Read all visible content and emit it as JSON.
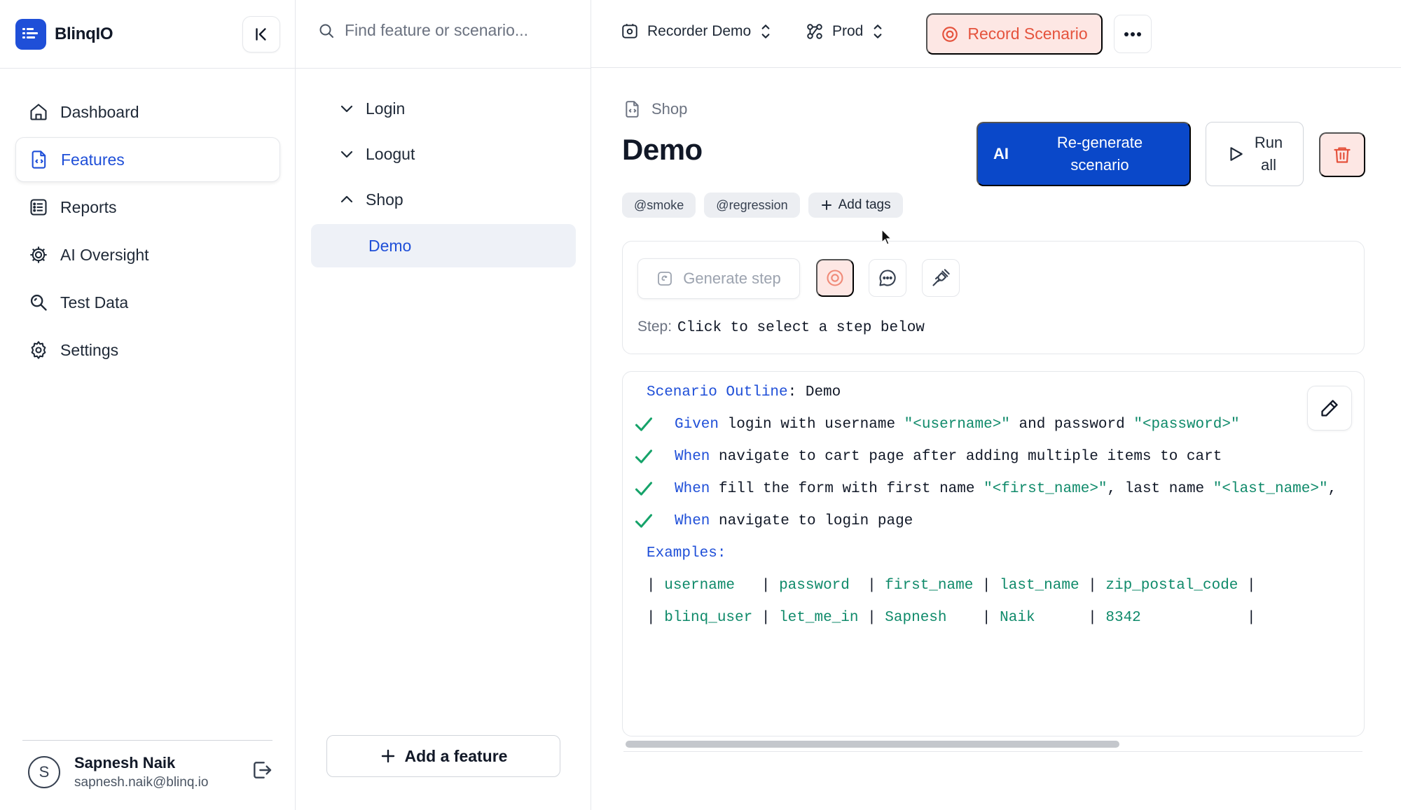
{
  "app": {
    "brand_name": "BlinqIO",
    "accent_color": "#1f4fd8",
    "danger_color": "#e5533d"
  },
  "sidebar": {
    "items": [
      {
        "label": "Dashboard",
        "icon": "home-icon"
      },
      {
        "label": "Features",
        "icon": "feature-file-icon",
        "active": true
      },
      {
        "label": "Reports",
        "icon": "list-icon"
      },
      {
        "label": "AI Oversight",
        "icon": "ai-gear-icon"
      },
      {
        "label": "Test Data",
        "icon": "magnifier-icon"
      },
      {
        "label": "Settings",
        "icon": "gear-icon"
      }
    ],
    "user": {
      "initial": "S",
      "name": "Sapnesh Naik",
      "email": "sapnesh.naik@blinq.io"
    }
  },
  "features_panel": {
    "search_placeholder": "Find feature or scenario...",
    "tree": [
      {
        "label": "Login",
        "expanded": false
      },
      {
        "label": "Loogut",
        "expanded": false
      },
      {
        "label": "Shop",
        "expanded": true
      }
    ],
    "selected_child": "Demo",
    "add_feature_label": "Add a feature"
  },
  "topbar": {
    "project": "Recorder Demo",
    "environment": "Prod",
    "record_label": "Record Scenario"
  },
  "scenario": {
    "breadcrumb": "Shop",
    "title": "Demo",
    "regen_ai": "AI",
    "regen_label_1": "Re-generate",
    "regen_label_2": "scenario",
    "run_label_1": "Run",
    "run_label_2": "all",
    "tags": [
      "@smoke",
      "@regression"
    ],
    "add_tags_label": "Add tags",
    "generate_step_label": "Generate step",
    "step_prefix": "Step:",
    "step_value": "Click to select a step below"
  },
  "gherkin": {
    "outline_keyword": "Scenario Outline",
    "outline_name": "Demo",
    "steps": [
      {
        "keyword": "Given",
        "parts": [
          {
            "t": "txt",
            "v": " login with username "
          },
          {
            "t": "str",
            "v": "\"<username>\""
          },
          {
            "t": "txt",
            "v": " and password "
          },
          {
            "t": "str",
            "v": "\"<password>\""
          }
        ]
      },
      {
        "keyword": "When",
        "parts": [
          {
            "t": "txt",
            "v": " navigate to cart page after adding multiple items to cart"
          }
        ]
      },
      {
        "keyword": "When",
        "parts": [
          {
            "t": "txt",
            "v": " fill the form with first name "
          },
          {
            "t": "str",
            "v": "\"<first_name>\""
          },
          {
            "t": "txt",
            "v": ", last name "
          },
          {
            "t": "str",
            "v": "\"<last_name>\""
          },
          {
            "t": "txt",
            "v": ","
          }
        ]
      },
      {
        "keyword": "When",
        "parts": [
          {
            "t": "txt",
            "v": " navigate to login page"
          }
        ]
      }
    ],
    "examples_label": "Examples:",
    "table_header": [
      "username  ",
      "password ",
      "first_name",
      "last_name",
      "zip_postal_code"
    ],
    "table_rows": [
      [
        "blinq_user",
        "let_me_in",
        "Sapnesh   ",
        "Naik     ",
        "8342           "
      ]
    ]
  }
}
